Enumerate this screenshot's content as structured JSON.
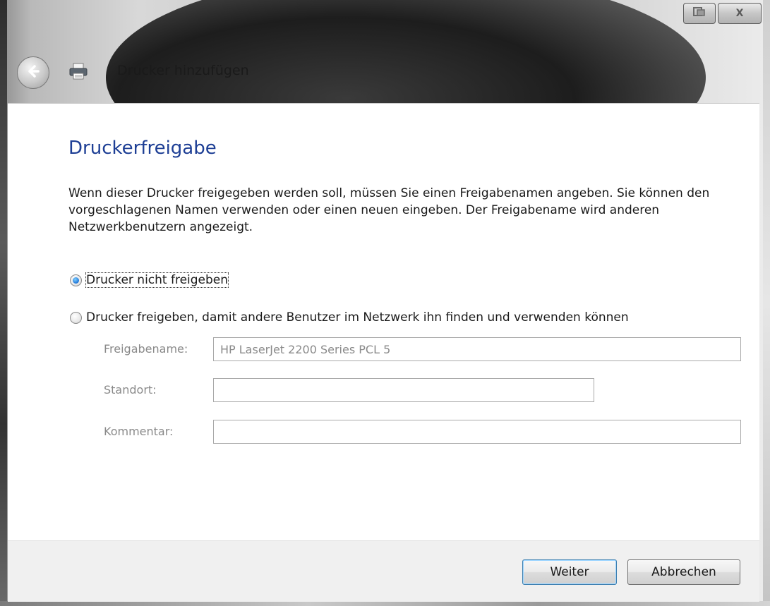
{
  "window": {
    "title": "Drucker hinzufügen",
    "controls": {
      "restore_icon": "restore-icon",
      "close_glyph": "X"
    }
  },
  "page": {
    "heading": "Druckerfreigabe",
    "description": "Wenn dieser Drucker freigegeben werden soll, müssen Sie einen Freigabenamen angeben. Sie können den vorgeschlagenen Namen verwenden oder einen neuen eingeben. Der Freigabename wird anderen Netzwerkbenutzern angezeigt.",
    "options": [
      {
        "label": "Drucker nicht freigeben",
        "checked": true
      },
      {
        "label": "Drucker freigeben, damit andere Benutzer im Netzwerk ihn finden und verwenden können",
        "checked": false
      }
    ],
    "fields": [
      {
        "label": "Freigabename:",
        "value": "HP LaserJet 2200 Series PCL 5",
        "enabled": false
      },
      {
        "label": "Standort:",
        "value": "",
        "enabled": false
      },
      {
        "label": "Kommentar:",
        "value": "",
        "enabled": false
      }
    ]
  },
  "footer": {
    "next_label": "Weiter",
    "cancel_label": "Abbrechen"
  },
  "colors": {
    "heading": "#1e3f95",
    "disabled_text": "#8a8a8a"
  }
}
